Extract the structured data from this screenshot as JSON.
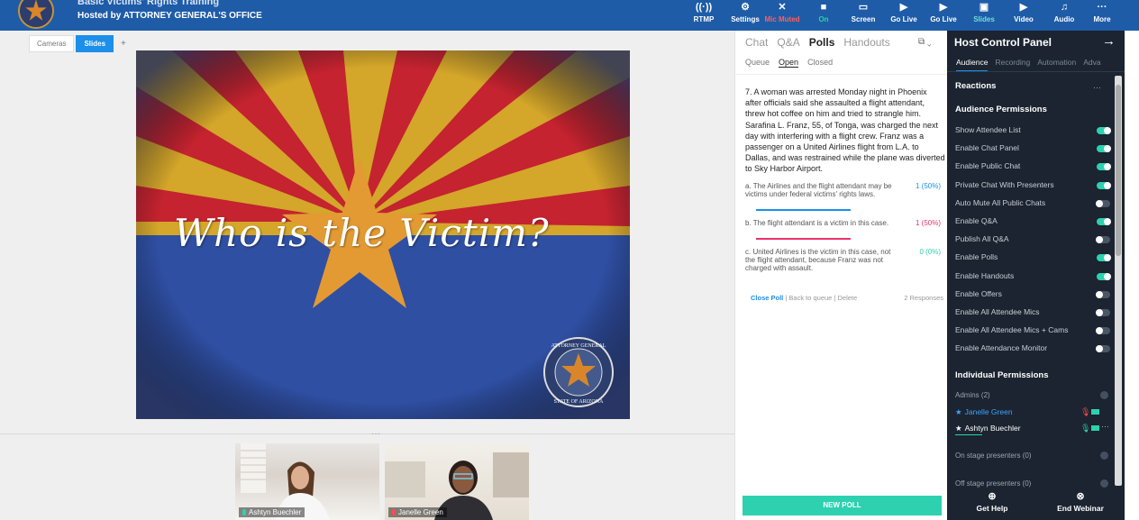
{
  "header": {
    "title": "Basic Victims' Rights Training",
    "host": "Hosted by ATTORNEY GENERAL'S OFFICE"
  },
  "toolbar": [
    {
      "icon": "rtmp-icon",
      "label": "RTMP",
      "state": "normal"
    },
    {
      "icon": "gear-icon",
      "label": "Settings",
      "state": "normal"
    },
    {
      "icon": "mic-muted-icon",
      "label": "Mic Muted",
      "state": "red"
    },
    {
      "icon": "camera-icon",
      "label": "On",
      "state": "green"
    },
    {
      "icon": "screen-icon",
      "label": "Screen",
      "state": "normal"
    },
    {
      "icon": "go-live-icon",
      "label": "Go Live",
      "state": "normal"
    },
    {
      "icon": "youtube-icon",
      "label": "Go Live",
      "state": "normal"
    },
    {
      "icon": "slides-icon",
      "label": "Slides",
      "state": "teal"
    },
    {
      "icon": "video-icon",
      "label": "Video",
      "state": "normal"
    },
    {
      "icon": "audio-icon",
      "label": "Audio",
      "state": "normal"
    },
    {
      "icon": "more-icon",
      "label": "More",
      "state": "normal"
    }
  ],
  "view_tabs": {
    "cameras": "Cameras",
    "slides": "Slides",
    "add": "+"
  },
  "slide": {
    "headline": "Who is the Victim?",
    "seal_top": "ATTORNEY GENERAL",
    "seal_bottom": "STATE OF ARIZONA"
  },
  "videos": [
    {
      "name": "Ashtyn Buechler",
      "mic_color": "#2dd1b0"
    },
    {
      "name": "Janelle Green",
      "mic_color": "#ff4b4b"
    }
  ],
  "polls_panel": {
    "tabs": [
      "Chat",
      "Q&A",
      "Polls",
      "Handouts"
    ],
    "active_tab": "Polls",
    "subtabs": [
      "Queue",
      "Open",
      "Closed"
    ],
    "active_subtab": "Open",
    "question": "7. A woman was arrested Monday night in Phoenix after officials said she assaulted a flight attendant, threw hot coffee on him and tried to strangle him. Sarafina L. Franz, 55, of Tonga, was charged the next day with interfering with a flight crew. Franz was a passenger on a United Airlines flight from L.A. to Dallas, and was restrained while the plane was diverted to Sky Harbor Airport.",
    "options": [
      {
        "text": "a. The Airlines and the flight attendant may be victims under federal victims' rights laws.",
        "result": "1 (50%)",
        "share": 0.5,
        "color": "#1b8fea"
      },
      {
        "text": "b. The flight attendant is a victim in this case.",
        "result": "1 (50%)",
        "share": 0.5,
        "color": "#e8326a"
      },
      {
        "text": "c. United Airlines is the victim in this case, not the flight attendant, because Franz was not charged with assault.",
        "result": "0 (0%)",
        "share": 0,
        "color": "#2dd1b0"
      }
    ],
    "actions": {
      "close": "Close Poll",
      "back": "Back to queue",
      "delete": "Delete",
      "responses": "2 Responses"
    },
    "new_poll": "NEW POLL"
  },
  "host_panel": {
    "title": "Host Control Panel",
    "tabs": [
      "Audience",
      "Recording",
      "Automation",
      "Adva"
    ],
    "active_tab": "Audience",
    "reactions": "Reactions",
    "audience_permissions_title": "Audience Permissions",
    "permissions": [
      {
        "label": "Show Attendee List",
        "on": true
      },
      {
        "label": "Enable Chat Panel",
        "on": true
      },
      {
        "label": "Enable Public Chat",
        "on": true
      },
      {
        "label": "Private Chat With Presenters",
        "on": true
      },
      {
        "label": "Auto Mute All Public Chats",
        "on": false
      },
      {
        "label": "Enable Q&A",
        "on": true
      },
      {
        "label": "Publish All Q&A",
        "on": false
      },
      {
        "label": "Enable Polls",
        "on": true
      },
      {
        "label": "Enable Handouts",
        "on": true
      },
      {
        "label": "Enable Offers",
        "on": false
      },
      {
        "label": "Enable All Attendee Mics",
        "on": false
      },
      {
        "label": "Enable All Attendee Mics + Cams",
        "on": false
      },
      {
        "label": "Enable Attendance Monitor",
        "on": false
      }
    ],
    "individual_title": "Individual Permissions",
    "admins": "Admins (2)",
    "admin_list": [
      {
        "name": "Janelle Green",
        "color": "#3ea4ff"
      },
      {
        "name": "Ashtyn Buechler",
        "color": "#ffffff"
      }
    ],
    "on_stage": "On stage presenters (0)",
    "off_stage": "Off stage presenters (0)",
    "footer": {
      "help": "Get Help",
      "end": "End Webinar"
    }
  },
  "colors": {
    "topbar": "#1f5ca8",
    "accent": "#1b8fea",
    "teal": "#2dd1b0",
    "panel_dark": "#1b2430"
  }
}
